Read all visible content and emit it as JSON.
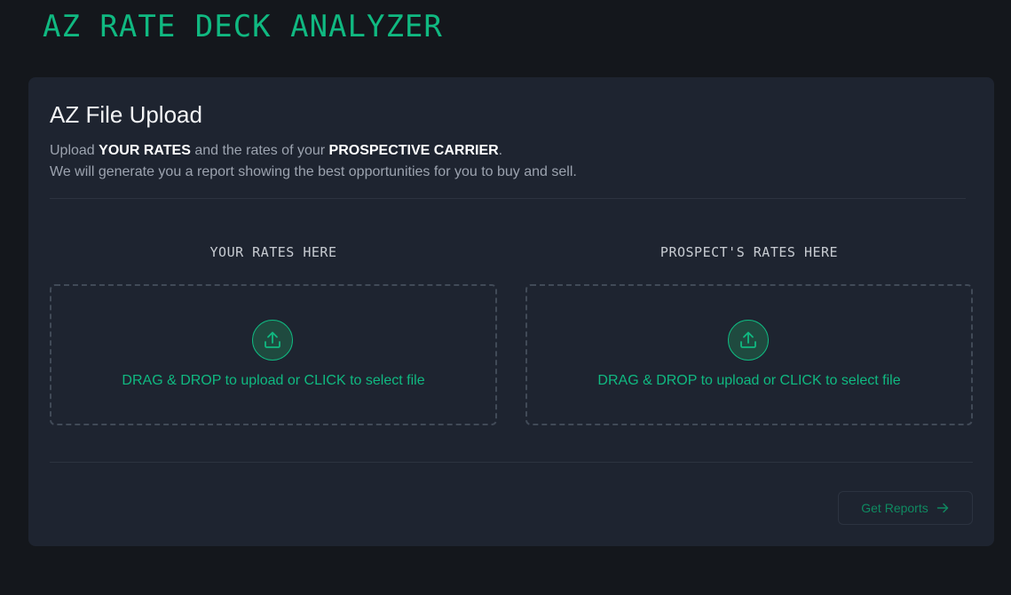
{
  "app": {
    "title": "AZ RATE DECK ANALYZER"
  },
  "upload_card": {
    "title": "AZ File Upload",
    "description": {
      "line1_prefix": "Upload ",
      "line1_bold1": "YOUR RATES",
      "line1_middle": " and the rates of your ",
      "line1_bold2": "PROSPECTIVE CARRIER",
      "line1_suffix": ".",
      "line2": "We will generate you a report showing the best opportunities for you to buy and sell."
    },
    "columns": [
      {
        "label": "YOUR RATES HERE",
        "dropzone_text": "DRAG & DROP to upload or CLICK to select file",
        "icon": "upload-icon"
      },
      {
        "label": "PROSPECT'S RATES HERE",
        "dropzone_text": "DRAG & DROP to upload or CLICK to select file",
        "icon": "upload-icon"
      }
    ],
    "get_reports_label": "Get Reports",
    "get_reports_icon": "arrow-right-icon"
  },
  "colors": {
    "background": "#14171c",
    "card": "#1e2430",
    "accent": "#10b981",
    "text_muted": "#9ca3af"
  }
}
